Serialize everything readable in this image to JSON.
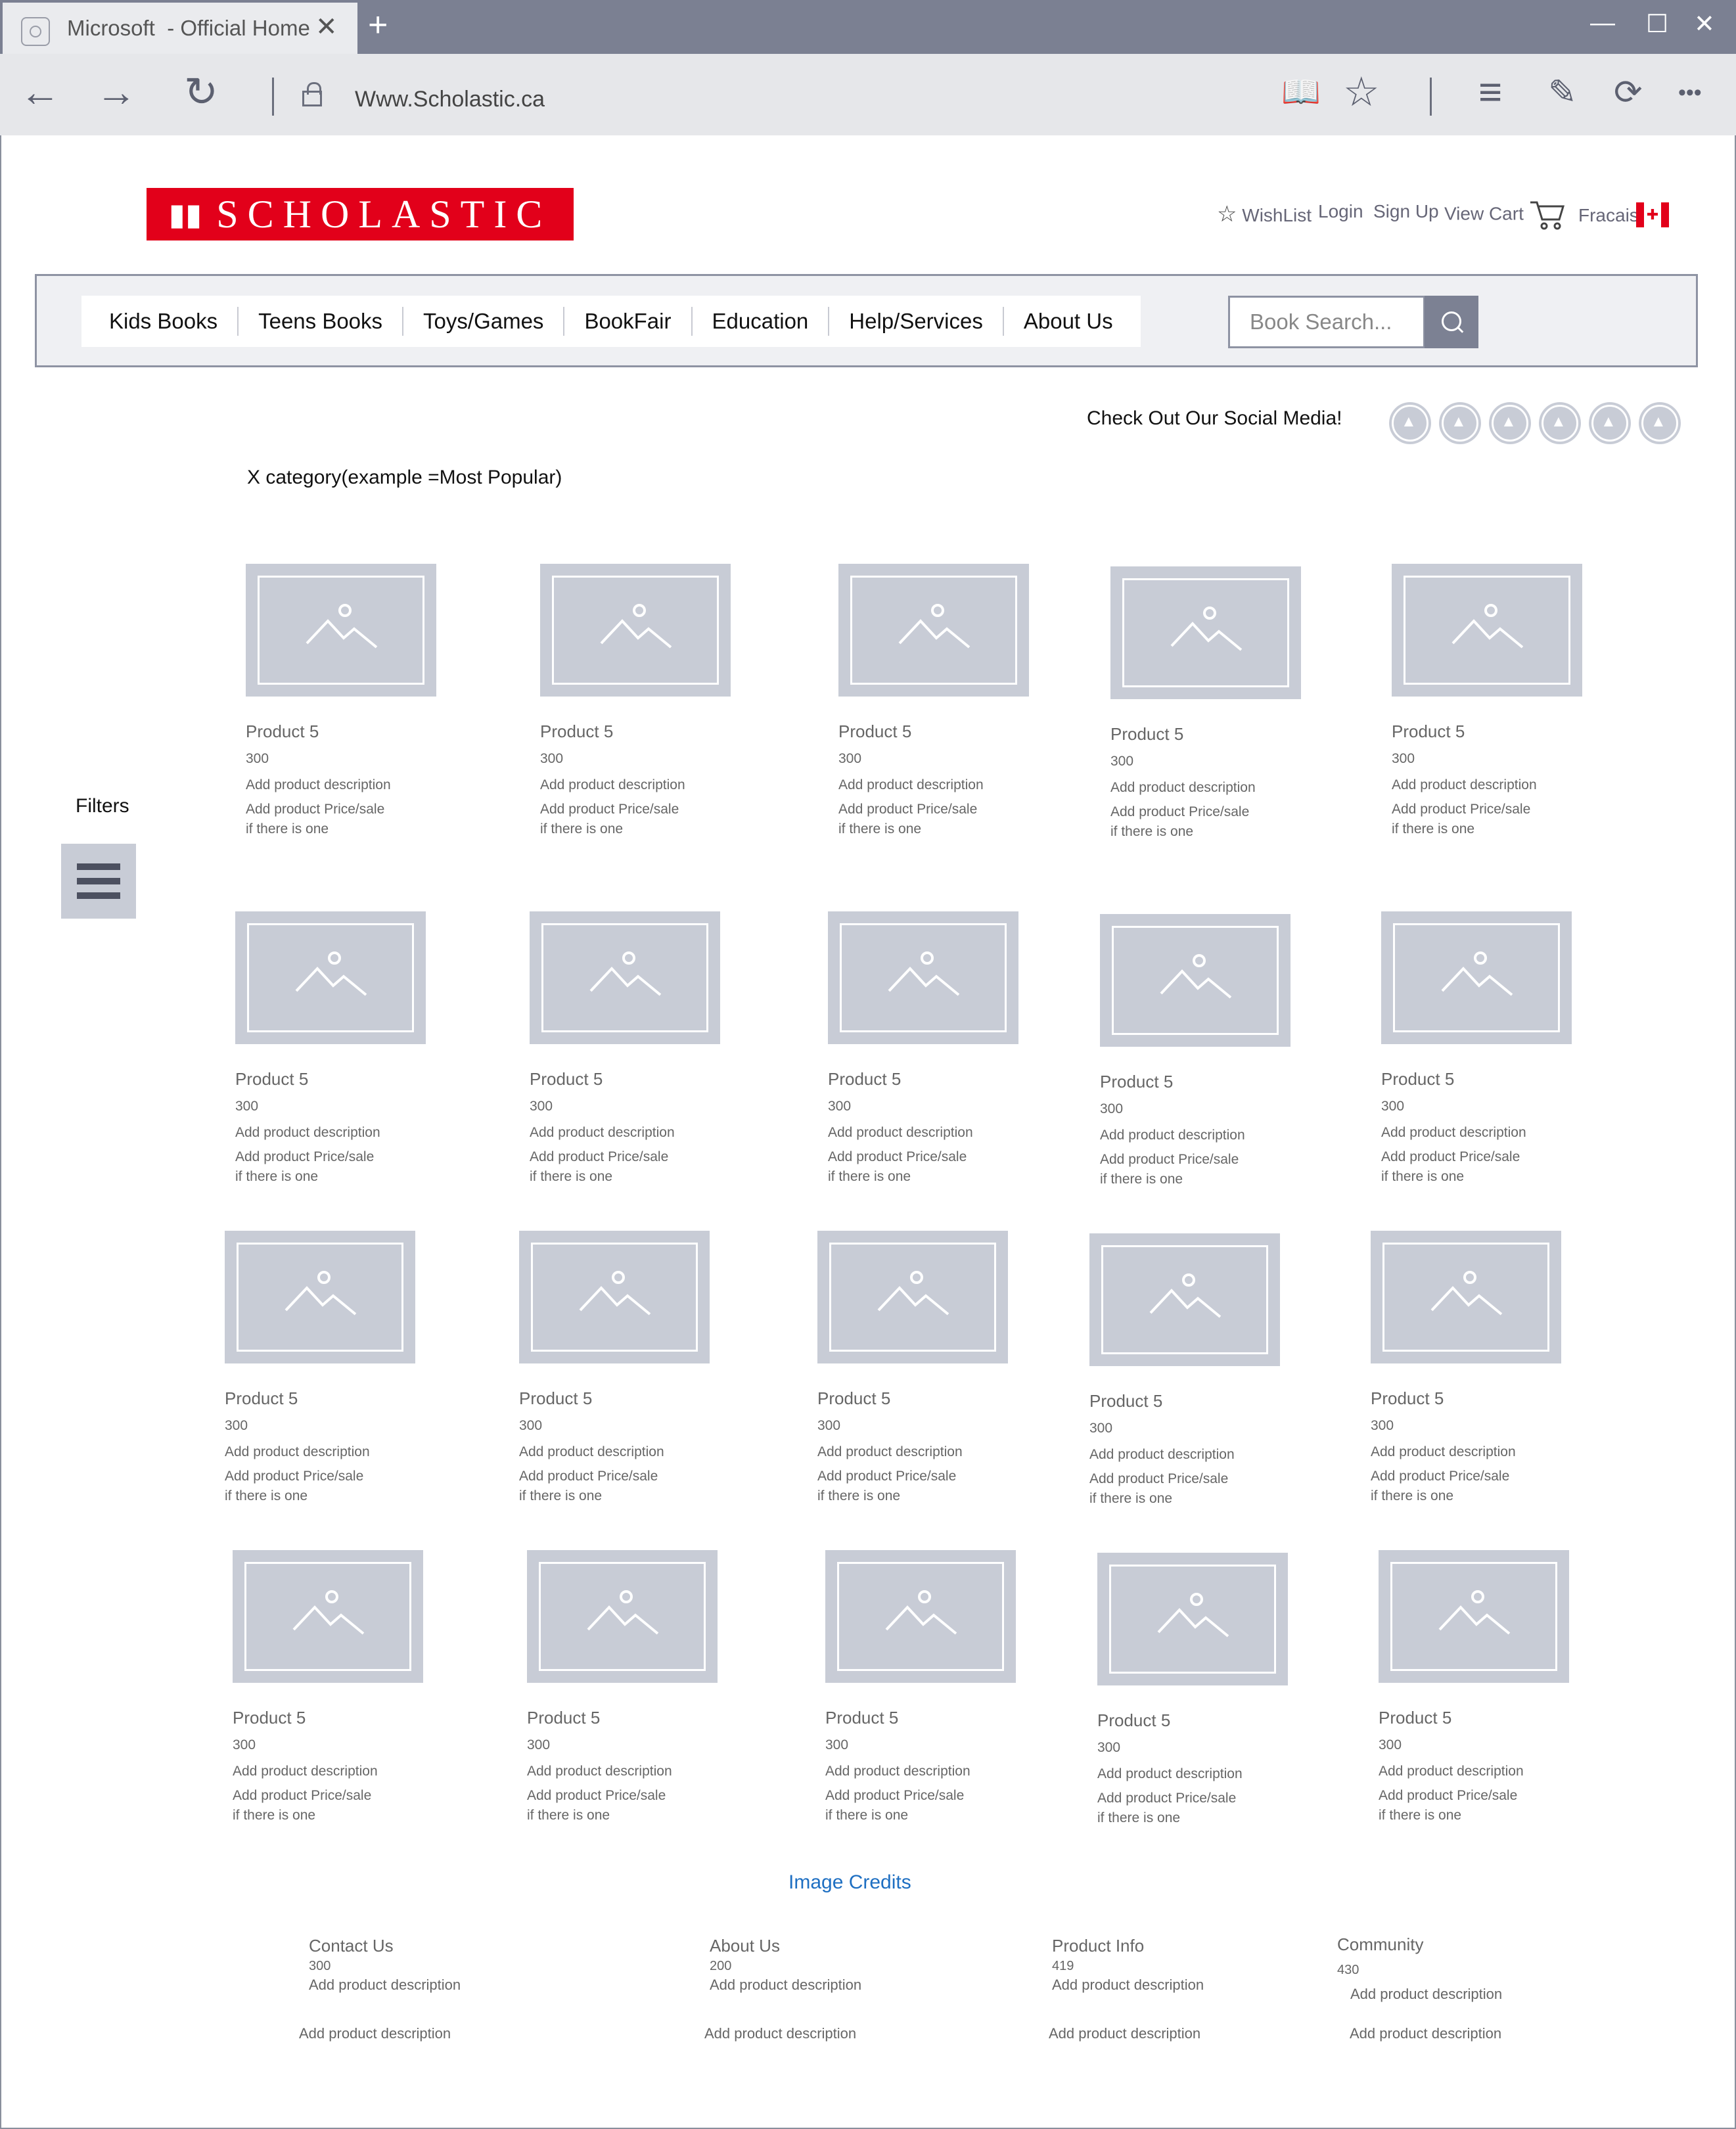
{
  "browser": {
    "tab_title": "Microsoft  - Official Home",
    "tab_close": "✕",
    "new_tab": "+",
    "url": "Www.Scholastic.ca",
    "window_controls": {
      "minimize": "—",
      "maximize": "☐",
      "close": "✕"
    },
    "nav_icons": {
      "back": "←",
      "forward": "→",
      "refresh": "↻",
      "reading": "📖",
      "favorite": "☆",
      "hub": "≡",
      "notes": "✎",
      "share": "⟳",
      "more": "•••"
    }
  },
  "header": {
    "logo_text": "SCHOLASTIC",
    "wishlist": "WishList",
    "login": "Login",
    "signup": "Sign Up",
    "view_cart": "View Cart",
    "language": "Fracais",
    "flag_glyph": "✚"
  },
  "menu": {
    "items": [
      "Kids Books",
      "Teens Books",
      "Toys/Games",
      "BookFair",
      "Education",
      "Help/Services",
      "About Us"
    ],
    "search_placeholder": "Book Search..."
  },
  "social": {
    "label": "Check Out Our Social Media!"
  },
  "category_label": "X category(example =Most Popular)",
  "filters_label": "Filters",
  "products": [
    {
      "name": "Product 5",
      "price": "300",
      "desc": "Add product description",
      "sale1": "Add product Price/sale",
      "sale2": "if there is one"
    }
  ],
  "image_credits": "Image Credits",
  "footer": [
    {
      "title": "Contact Us",
      "num": "300",
      "desc": "Add product description",
      "desc2": "Add product description"
    },
    {
      "title": "About Us",
      "num": "200",
      "desc": "Add product description",
      "desc2": "Add product description"
    },
    {
      "title": "Product Info",
      "num": "419",
      "desc": "Add product description",
      "desc2": "Add product description"
    },
    {
      "title": "Community",
      "num": "430",
      "desc": "Add product description",
      "desc2": "Add product description"
    }
  ],
  "colors": {
    "brand_red": "#e2001a",
    "chrome_gray": "#7b8092",
    "placeholder_gray": "#c8ccd6",
    "link_blue": "#1e6fc2"
  }
}
